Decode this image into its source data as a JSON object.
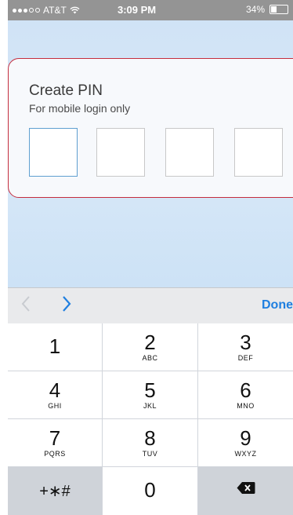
{
  "status_bar": {
    "carrier": "AT&T",
    "time": "3:09 PM",
    "battery_percent": "34%"
  },
  "pin_card": {
    "title": "Create PIN",
    "subtitle": "For mobile login only",
    "box_count": 4,
    "active_index": 0,
    "border_color": "#c52d3e"
  },
  "keyboard_accessory": {
    "done_label": "Done",
    "prev_icon": "chevron-left-icon",
    "next_icon": "chevron-right-icon",
    "accent_color": "#1f7fe0"
  },
  "keypad": {
    "keys": [
      {
        "digit": "1",
        "letters": ""
      },
      {
        "digit": "2",
        "letters": "ABC"
      },
      {
        "digit": "3",
        "letters": "DEF"
      },
      {
        "digit": "4",
        "letters": "GHI"
      },
      {
        "digit": "5",
        "letters": "JKL"
      },
      {
        "digit": "6",
        "letters": "MNO"
      },
      {
        "digit": "7",
        "letters": "PQRS"
      },
      {
        "digit": "8",
        "letters": "TUV"
      },
      {
        "digit": "9",
        "letters": "WXYZ"
      },
      {
        "digit": "0",
        "letters": ""
      }
    ],
    "symbols_label": "+∗#",
    "delete_icon": "backspace-icon"
  }
}
